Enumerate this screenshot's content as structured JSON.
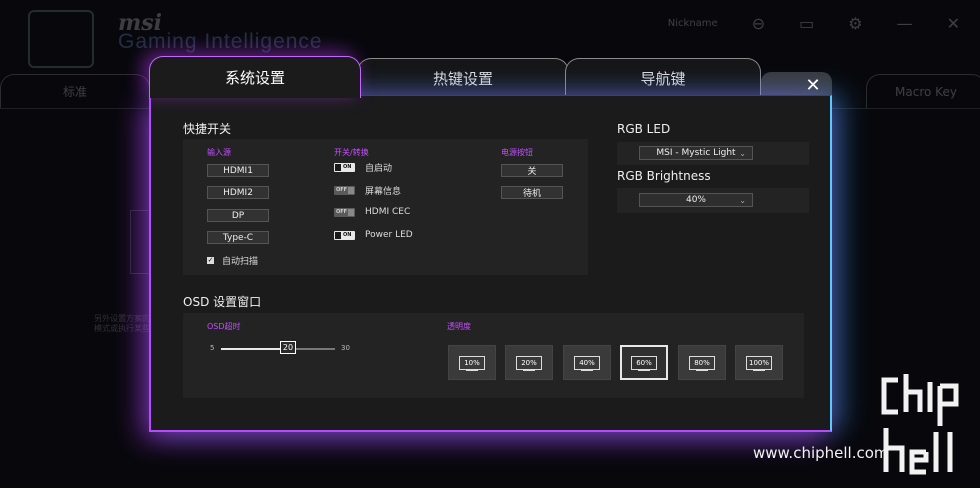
{
  "background_app": {
    "brand": "msi",
    "title": "Gaming Intelligence",
    "std_tab": "标准",
    "macro_tab": "Macro Key",
    "nickname": "Nickname",
    "side_text": "另外设置方案的\n模式或执行某些"
  },
  "tabs": [
    {
      "label": "系统设置",
      "active": true
    },
    {
      "label": "热键设置",
      "active": false
    },
    {
      "label": "导航键",
      "active": false
    }
  ],
  "close_label": "✕",
  "quick_switch": {
    "title": "快捷开关",
    "input_source": {
      "title": "输入源",
      "items": [
        "HDMI1",
        "HDMI2",
        "DP",
        "Type-C"
      ],
      "auto_scan": "自动扫描",
      "auto_scan_checked": true
    },
    "toggle": {
      "title": "开关/转换",
      "items": [
        {
          "label": "自启动",
          "state": "ON"
        },
        {
          "label": "屏幕信息",
          "state": "OFF"
        },
        {
          "label": "HDMI CEC",
          "state": "OFF"
        },
        {
          "label": "Power LED",
          "state": "ON"
        }
      ]
    },
    "power": {
      "title": "电源按钮",
      "items": [
        "关",
        "待机"
      ]
    }
  },
  "rgb_led": {
    "title": "RGB LED",
    "value": "MSI - Mystic Light",
    "brightness_title": "RGB Brightness",
    "brightness_value": "40%"
  },
  "osd": {
    "title": "OSD 设置窗口",
    "timeout_title": "OSD超时",
    "timeout_min": "5",
    "timeout_max": "30",
    "timeout_value": "20",
    "transparency_title": "透明度",
    "transparency_options": [
      "10%",
      "20%",
      "40%",
      "60%",
      "80%",
      "100%"
    ],
    "transparency_selected": "60%"
  },
  "watermark": {
    "site": "www.chiphell.com",
    "logo_text": "chip hell"
  },
  "colors": {
    "accent_purple": "#c44dff",
    "glow_blue": "#5cc8ff"
  }
}
